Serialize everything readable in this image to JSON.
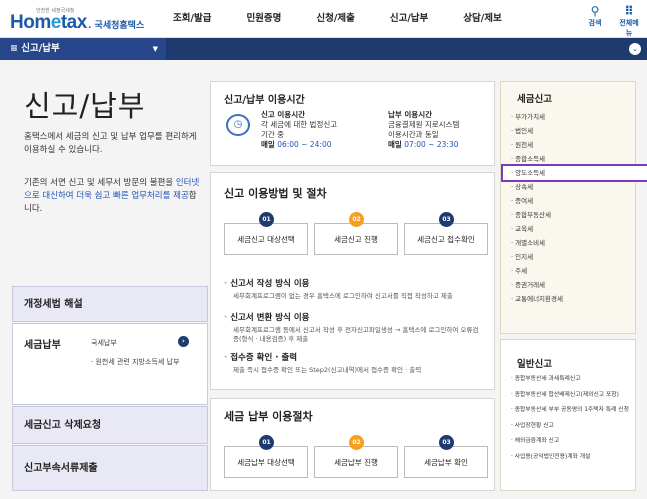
{
  "header": {
    "logo_tag": "안전한 세정국세청",
    "logo_brand_1": "Hom",
    "logo_brand_2": "e",
    "logo_brand_3": "tax",
    "logo_org": ". 국세청홈택스",
    "menu": [
      "조회/발급",
      "민원증명",
      "신청/제출",
      "신고/납부",
      "상담/제보"
    ],
    "search_label": "검색",
    "allmenu_label": "전체메뉴"
  },
  "breadcrumb": {
    "label": "≡  신고/납부"
  },
  "left": {
    "title": "신고/납부",
    "desc1": "홈택스에서 세금의 신고 및 납부 업무를 편리하게 이용하실 수 있습니다.",
    "desc2_a": "기존의 서면 신고 및 세무서 방문의 불편을 ",
    "desc2_hl": "인터넷으로 대신하여 더욱 쉽고 빠른 업무처리를 제공",
    "desc2_b": "합니다.",
    "boxes": {
      "law": "개정세법 해설",
      "pay": "세금납부",
      "pay_sub1": "국세납부",
      "pay_sub2": "· 원천세 관련 지방소득세 납부",
      "delete": "세금신고 삭제요청",
      "attach": "신고부속서류제출"
    }
  },
  "center": {
    "hours": {
      "title": "신고/납부 이용시간",
      "report_title": "신고 이용시간",
      "report_l1": "각 세금에 대한 법정신고",
      "report_l2": "기간 중",
      "report_daily": "매일",
      "report_time": "06:00 ~ 24:00",
      "pay_title": "납부 이용시간",
      "pay_l1": "금융결제원 지로시스템",
      "pay_l2": "이용시간과 동일",
      "pay_daily": "매일",
      "pay_time": "07:00 ~ 23:30"
    },
    "method": {
      "title": "신고 이용방법 및 절차",
      "steps": [
        {
          "num": "01",
          "label": "세금신고 대상선택"
        },
        {
          "num": "02",
          "label": "세금신고 진행"
        },
        {
          "num": "03",
          "label": "세금신고 접수확인"
        }
      ],
      "items": [
        {
          "head": "신고서 작성 방식 이용",
          "desc": "세무회계프로그램이 없는 경우 홈택스에 로그인하여 신고서를 직접 작성하고 제출"
        },
        {
          "head": "신고서 변환 방식 이용",
          "desc": "세무회계프로그램 등에서 신고서 작성 후 전자신고파일생성 → 홈택스에 로그인하여 오류검증(형식 · 내용검증) 후 제출"
        },
        {
          "head": "접수증 확인 · 출력",
          "desc": "제출 즉시 접수증 확인 또는 Step2(신고내역)에서 접수증 확인 · 출력"
        }
      ]
    },
    "payproc": {
      "title": "세금 납부 이용절차",
      "steps": [
        {
          "num": "01",
          "label": "세금납부 대상선택"
        },
        {
          "num": "02",
          "label": "세금납부 진행"
        },
        {
          "num": "03",
          "label": "세금납부 확인"
        }
      ]
    }
  },
  "right": {
    "tax_title": "세금신고",
    "tax_items": [
      "부가가치세",
      "법인세",
      "원천세",
      "종합소득세",
      "양도소득세",
      "상속세",
      "증여세",
      "종합부동산세",
      "교육세",
      "개별소비세",
      "인지세",
      "주세",
      "증권거래세",
      "교통에너지환경세"
    ],
    "general_title": "일반신고",
    "general_items": [
      "종합부동산세 과세특례신고",
      "종합부동산세 합산배제신고(제외신고 포함)",
      "종합부동산세 부부 공동명의 1주택자 특례 신청",
      "사업장현황 신고",
      "해외금융계좌 신고",
      "사업용(공익법인전용)계좌 개설"
    ]
  },
  "colors": {
    "navy": "#1e3a6e",
    "orange": "#f7a020",
    "highlight": "#7c3ac0"
  }
}
